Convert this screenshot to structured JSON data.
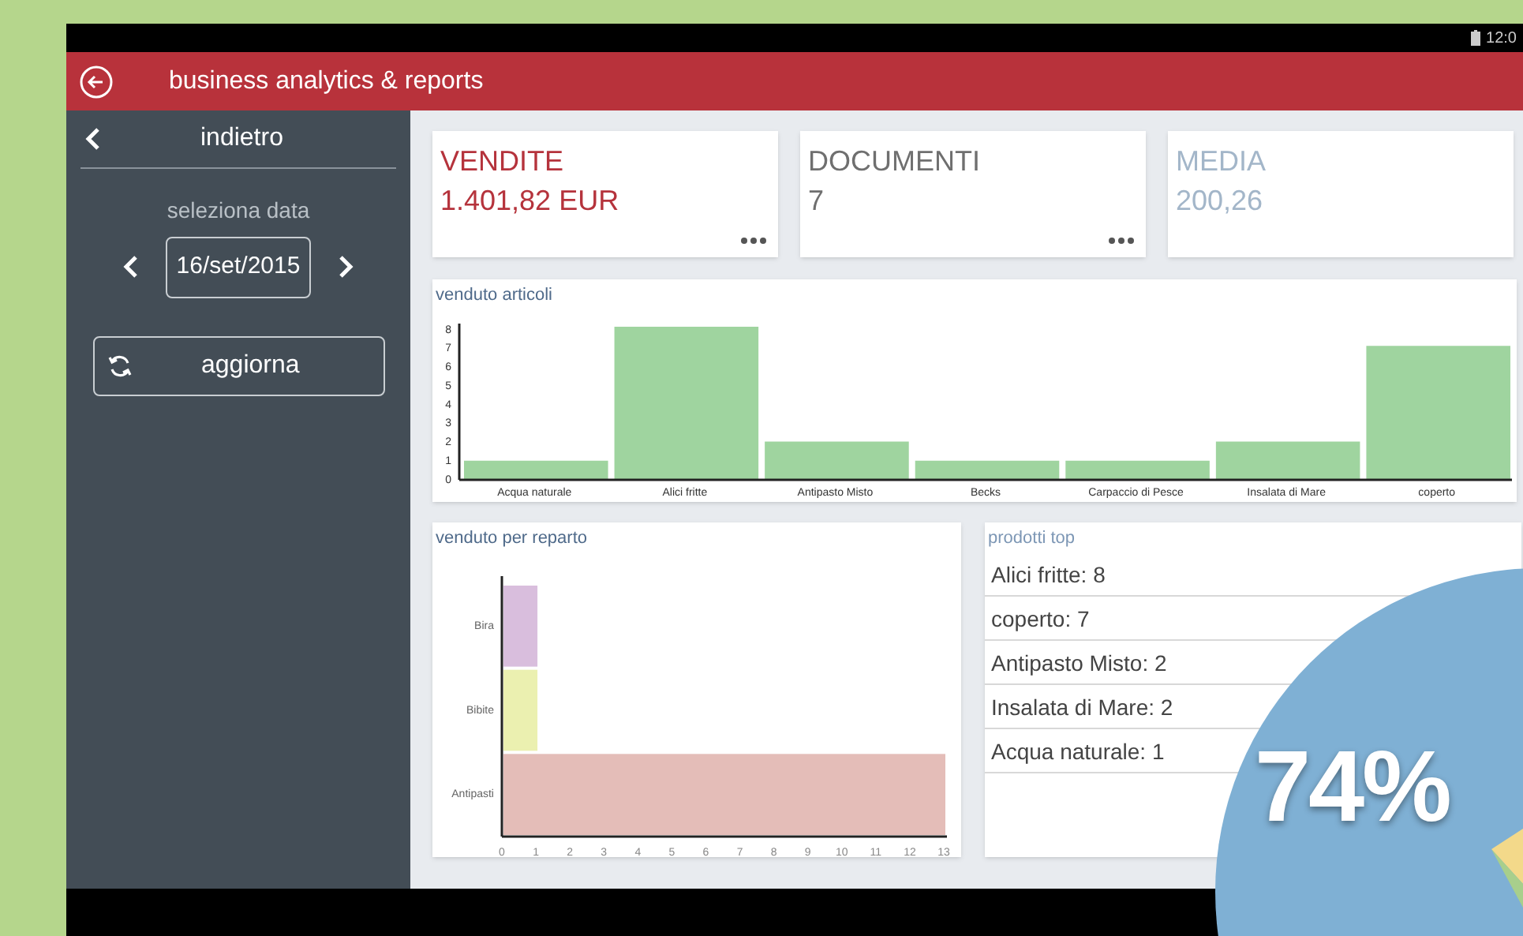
{
  "status_bar": {
    "time": "12:0"
  },
  "app_bar": {
    "title": "business analytics & reports"
  },
  "sidebar": {
    "back_label": "indietro",
    "date_label": "seleziona data",
    "date": "16/set/2015",
    "refresh_button": "aggiorna"
  },
  "kpi_cards": [
    {
      "title": "VENDITE",
      "value": "1.401,82 EUR",
      "color": "#b5333c",
      "has_menu": true
    },
    {
      "title": "DOCUMENTI",
      "value": "7",
      "color": "#6f6f6f",
      "has_menu": true
    },
    {
      "title": "MEDIA",
      "value": "200,26",
      "color": "#a3b6c9",
      "has_menu": false
    }
  ],
  "sold_items": {
    "title": "venduto articoli",
    "chart_data": {
      "type": "bar",
      "categories": [
        "Acqua naturale",
        "Alici fritte",
        "Antipasto Misto",
        "Becks",
        "Carpaccio di Pesce",
        "Insalata di Mare",
        "coperto"
      ],
      "series": [
        {
          "color": "#9fd49f",
          "values": [
            1,
            8,
            2,
            1,
            1,
            2,
            7
          ]
        }
      ],
      "ylim": [
        0,
        8
      ],
      "yticks": [
        0,
        1,
        2,
        3,
        4,
        5,
        6,
        7,
        8
      ]
    }
  },
  "sold_by_department": {
    "title": "venduto per reparto",
    "chart_data": {
      "type": "bar",
      "orientation": "horizontal",
      "categories": [
        "Bira",
        "Bibite",
        "Antipasti"
      ],
      "stacked": true,
      "series": [
        {
          "color": "#d9bedd",
          "values": [
            1,
            null,
            null
          ]
        },
        {
          "color": "#ebf0b0",
          "values": [
            null,
            1,
            null
          ]
        },
        {
          "color": "#e4bdb8",
          "values": [
            null,
            null,
            13
          ]
        }
      ],
      "xlim": [
        0,
        13
      ],
      "xticks": [
        0,
        1,
        2,
        3,
        4,
        5,
        6,
        7,
        8,
        9,
        10,
        11,
        12,
        13
      ]
    }
  },
  "top_products": {
    "title": "prodotti top",
    "items": [
      "Alici fritte: 8",
      "coperto: 7",
      "Antipasto Misto: 2",
      "Insalata di Mare: 2",
      "Acqua naturale: 1"
    ]
  },
  "overlay": {
    "percentage": "74%"
  }
}
